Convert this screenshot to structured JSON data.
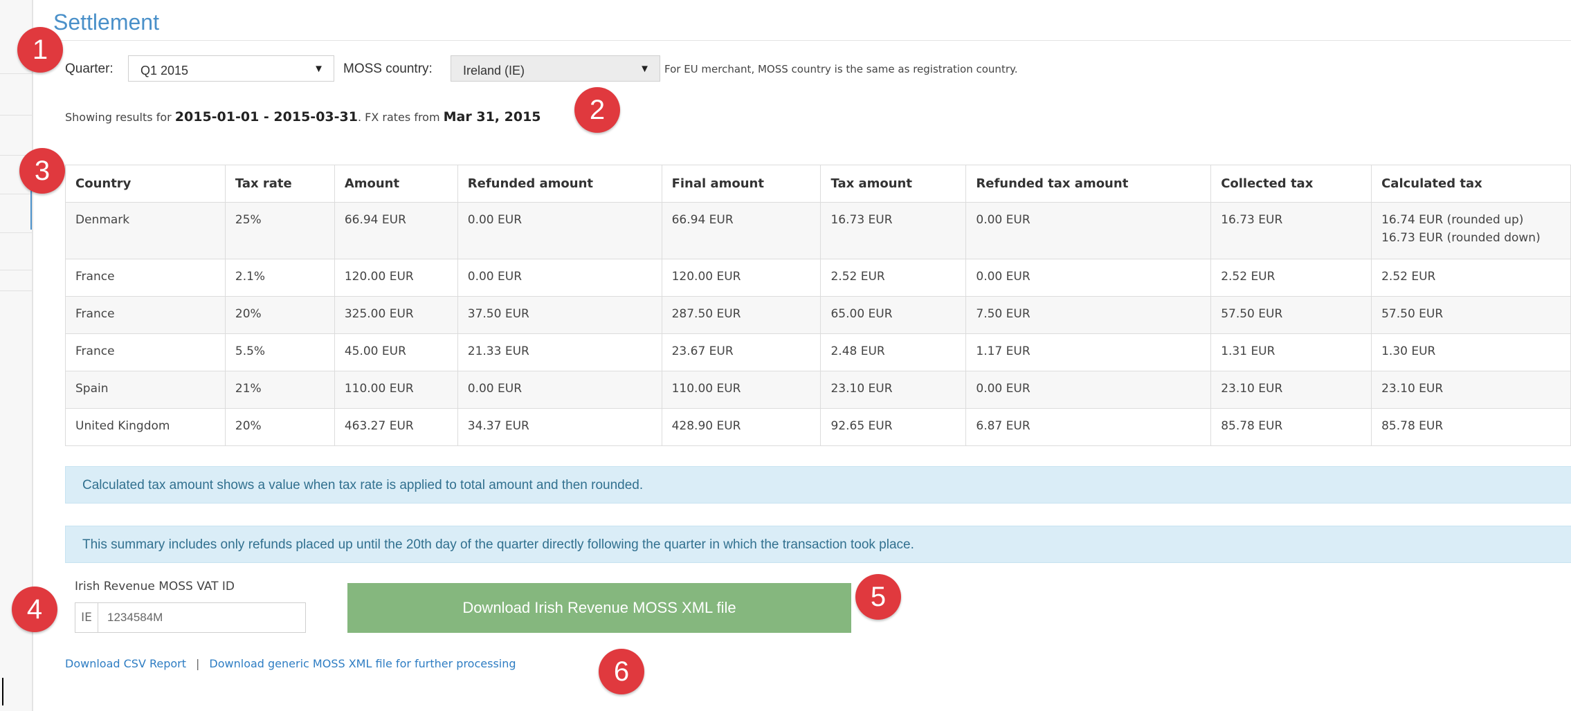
{
  "page": {
    "title": "Settlement"
  },
  "filters": {
    "quarter_label": "Quarter:",
    "quarter_value": "Q1 2015",
    "moss_country_label": "MOSS country:",
    "moss_country_value": "Ireland (IE)",
    "moss_note": "For EU merchant, MOSS country is the same as registration country."
  },
  "summary": {
    "prefix": "Showing results for",
    "period": "2015-01-01 - 2015-03-31",
    "fx_prefix": ". FX rates from",
    "fx_date": "Mar 31, 2015"
  },
  "table": {
    "headers": [
      "Country",
      "Tax rate",
      "Amount",
      "Refunded amount",
      "Final amount",
      "Tax amount",
      "Refunded tax amount",
      "Collected tax",
      "Calculated tax"
    ],
    "rows": [
      {
        "country": "Denmark",
        "tax_rate": "25%",
        "amount": "66.94 EUR",
        "refunded_amount": "0.00 EUR",
        "final_amount": "66.94 EUR",
        "tax_amount": "16.73 EUR",
        "refunded_tax_amount": "0.00 EUR",
        "collected_tax": "16.73 EUR",
        "calculated_tax": "16.74 EUR (rounded up)",
        "calculated_tax_2": "16.73 EUR (rounded down)"
      },
      {
        "country": "France",
        "tax_rate": "2.1%",
        "amount": "120.00 EUR",
        "refunded_amount": "0.00 EUR",
        "final_amount": "120.00 EUR",
        "tax_amount": "2.52 EUR",
        "refunded_tax_amount": "0.00 EUR",
        "collected_tax": "2.52 EUR",
        "calculated_tax": "2.52 EUR"
      },
      {
        "country": "France",
        "tax_rate": "20%",
        "amount": "325.00 EUR",
        "refunded_amount": "37.50 EUR",
        "final_amount": "287.50 EUR",
        "tax_amount": "65.00 EUR",
        "refunded_tax_amount": "7.50 EUR",
        "collected_tax": "57.50 EUR",
        "calculated_tax": "57.50 EUR"
      },
      {
        "country": "France",
        "tax_rate": "5.5%",
        "amount": "45.00 EUR",
        "refunded_amount": "21.33 EUR",
        "final_amount": "23.67 EUR",
        "tax_amount": "2.48 EUR",
        "refunded_tax_amount": "1.17 EUR",
        "collected_tax": "1.31 EUR",
        "calculated_tax": "1.30 EUR"
      },
      {
        "country": "Spain",
        "tax_rate": "21%",
        "amount": "110.00 EUR",
        "refunded_amount": "0.00 EUR",
        "final_amount": "110.00 EUR",
        "tax_amount": "23.10 EUR",
        "refunded_tax_amount": "0.00 EUR",
        "collected_tax": "23.10 EUR",
        "calculated_tax": "23.10 EUR"
      },
      {
        "country": "United Kingdom",
        "tax_rate": "20%",
        "amount": "463.27 EUR",
        "refunded_amount": "34.37 EUR",
        "final_amount": "428.90 EUR",
        "tax_amount": "92.65 EUR",
        "refunded_tax_amount": "6.87 EUR",
        "collected_tax": "85.78 EUR",
        "calculated_tax": "85.78 EUR"
      }
    ]
  },
  "info": {
    "calculated_note": "Calculated tax amount shows a value when tax rate is applied to total amount and then rounded.",
    "refunds_note": "This summary includes only refunds placed up until the 20th day of the quarter directly following the quarter in which the transaction took place."
  },
  "vat": {
    "label": "Irish Revenue MOSS VAT ID",
    "prefix": "IE",
    "value": "1234584M"
  },
  "actions": {
    "download_xml": "Download Irish Revenue MOSS XML file",
    "download_csv": "Download CSV Report",
    "separator": "|",
    "download_generic": "Download generic MOSS XML file for further processing"
  },
  "badges": [
    "1",
    "2",
    "3",
    "4",
    "5",
    "6"
  ],
  "colors": {
    "accent": "#4a90c9",
    "badge": "#e0393e",
    "download_button": "#85b77e",
    "info_background": "#daedf7",
    "link": "#2e7dc3"
  },
  "icons": {
    "dropdown": "caret-down-icon"
  }
}
